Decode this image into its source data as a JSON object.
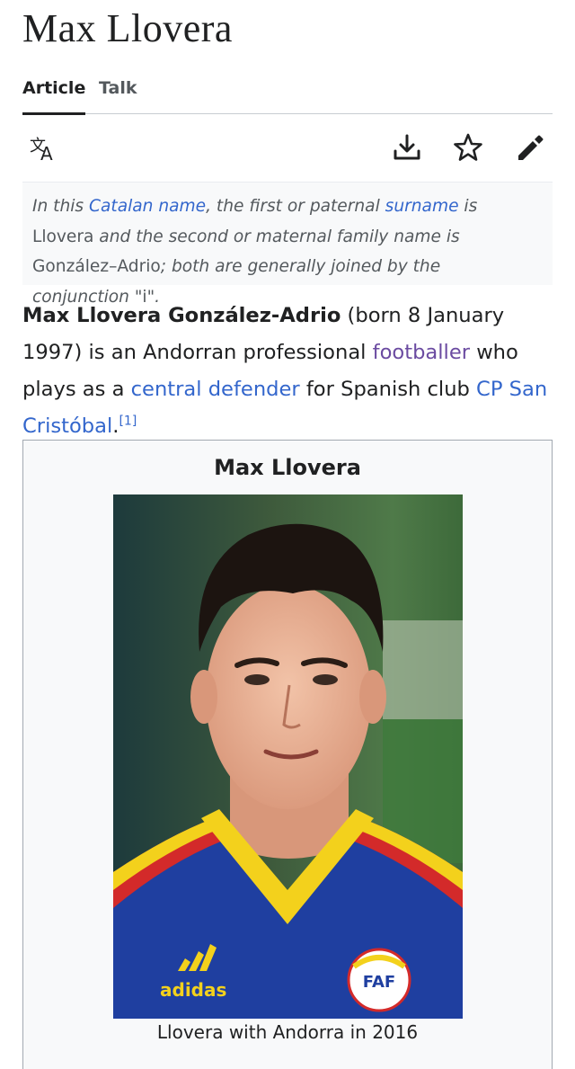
{
  "article": {
    "title": "Max Llovera"
  },
  "tabs": [
    {
      "label": "Article",
      "active": true
    },
    {
      "label": "Talk",
      "active": false
    }
  ],
  "toolbar": {
    "icons": [
      "language-icon",
      "download-icon",
      "star-icon",
      "edit-icon"
    ]
  },
  "hatnote": {
    "t1": "In this ",
    "link1": "Catalan name",
    "t2": ", the first or paternal ",
    "link2": "surname",
    "t3": " is ",
    "name1": "Llovera",
    "t4": " and the second or maternal family name is ",
    "name2": "González–Adrio",
    "t5": "; both are generally joined by the conjunction \"",
    "conj": "i",
    "t6": "\"."
  },
  "lead": {
    "bold_name": "Max Llovera González-Adrio",
    "t1": " (born 8 January 1997) is an Andorran professional ",
    "link_footballer": "footballer",
    "t2": " who plays as a ",
    "link_defender": "central defender",
    "t3": " for Spanish club ",
    "link_club": "CP San Cristóbal",
    "t4": ".",
    "ref": "[1]"
  },
  "infobox": {
    "title": "Max Llovera",
    "caption": "Llovera with Andorra in 2016",
    "photo_logo_text": "adidas",
    "photo_badge_text": "FAF"
  },
  "colors": {
    "link": "#3366cc",
    "visited_link": "#6b4ba1",
    "text": "#202122",
    "muted": "#54595d",
    "hatnote_bg": "#f8f9fa",
    "border": "#a2a9b1",
    "jersey_blue": "#1f3fa0",
    "jersey_yellow": "#f3d11c",
    "jersey_red": "#d32a2a"
  }
}
